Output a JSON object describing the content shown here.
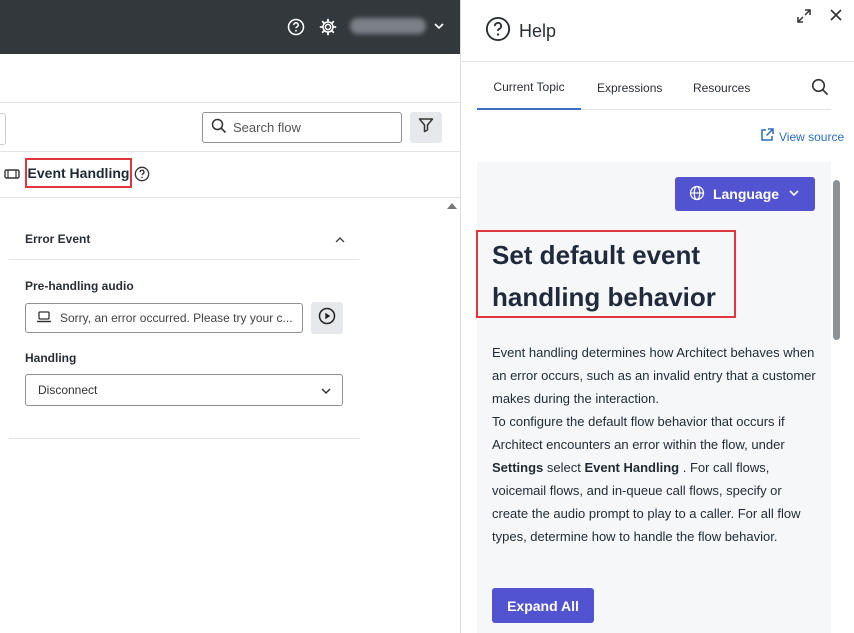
{
  "topbar": {
    "icons": [
      "help-circle-icon",
      "gear-icon",
      "chevron-down-icon"
    ]
  },
  "toolbar": {
    "search_placeholder": "Search flow",
    "filter_icon": "filter-icon"
  },
  "event_handling": {
    "label": "Event Handling"
  },
  "error_event": {
    "title": "Error Event",
    "pre_handling_label": "Pre-handling audio",
    "pre_handling_value": "Sorry, an error occurred. Please try your c...",
    "handling_label": "Handling",
    "handling_value": "Disconnect"
  },
  "help": {
    "title": "Help",
    "tabs": [
      {
        "label": "Current Topic",
        "active": true
      },
      {
        "label": "Expressions",
        "active": false
      },
      {
        "label": "Resources",
        "active": false
      }
    ],
    "view_source": "View source",
    "language_label": "Language",
    "heading_line1": "Set default event",
    "heading_line2": "handling behavior",
    "para1": "Event handling determines how Architect behaves when an error occurs, such as an invalid entry that a customer makes during the interaction.",
    "para2_a": "To configure the default flow behavior that occurs if Architect encounters an error within the flow, under ",
    "para2_b": "Settings",
    "para2_c": " select ",
    "para2_d": "Event Handling",
    "para2_e": " . For call flows, voicemail flows, and in-queue call flows, specify or create the audio prompt to play to a caller. For all flow types, determine how to handle the flow behavior.",
    "expand_all": "Expand All"
  },
  "colors": {
    "accent": "#5253d1",
    "highlight": "#e0373f",
    "topbar": "#33383d",
    "link": "#2a6ec3"
  }
}
